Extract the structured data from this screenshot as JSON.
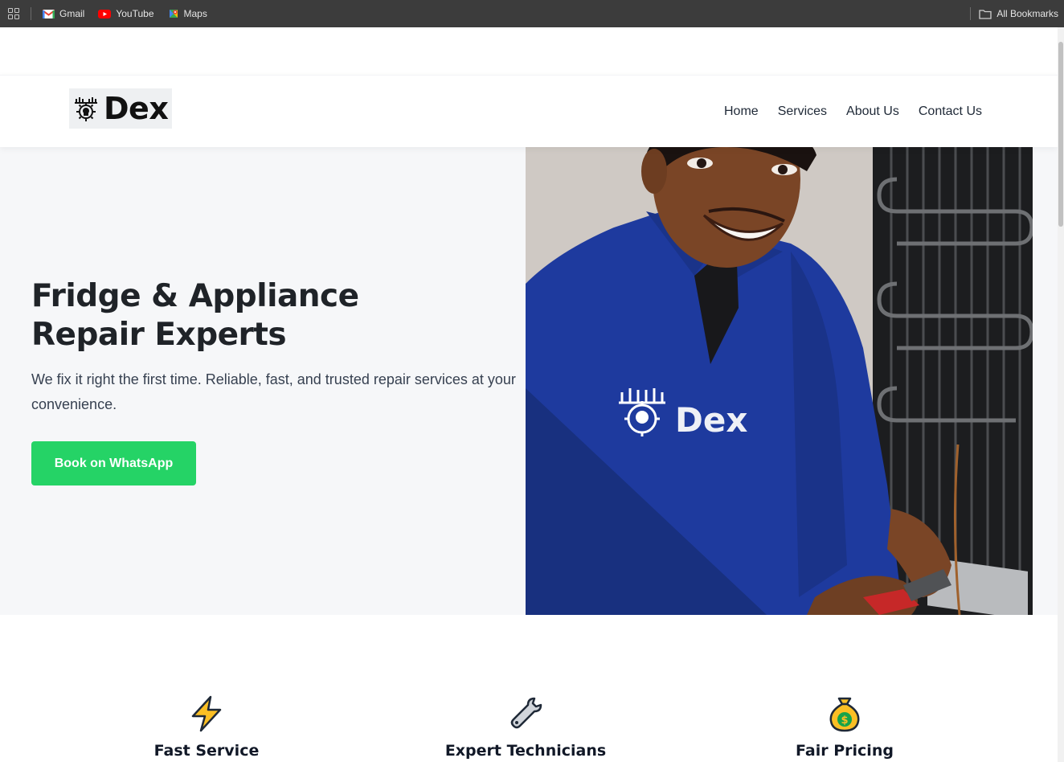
{
  "browser": {
    "bookmarks": [
      {
        "label": "Gmail",
        "icon": "gmail-icon"
      },
      {
        "label": "YouTube",
        "icon": "youtube-icon"
      },
      {
        "label": "Maps",
        "icon": "maps-icon"
      }
    ],
    "all_bookmarks": "All Bookmarks"
  },
  "header": {
    "logo_text": "Dex",
    "nav": [
      "Home",
      "Services",
      "About Us",
      "Contact Us"
    ]
  },
  "hero": {
    "title": "Fridge & Appliance Repair Experts",
    "subtitle": "We fix it right the first time. Reliable, fast, and trusted repair services at your convenience.",
    "cta_label": "Book on WhatsApp",
    "shirt_logo_text": "Dex"
  },
  "features": [
    {
      "title": "Fast Service",
      "icon": "lightning-icon"
    },
    {
      "title": "Expert Technicians",
      "icon": "wrench-icon"
    },
    {
      "title": "Fair Pricing",
      "icon": "money-bag-icon"
    }
  ],
  "colors": {
    "cta": "#25d366",
    "hero_bg": "#f6f7f9",
    "uniform": "#1e3a9e"
  }
}
